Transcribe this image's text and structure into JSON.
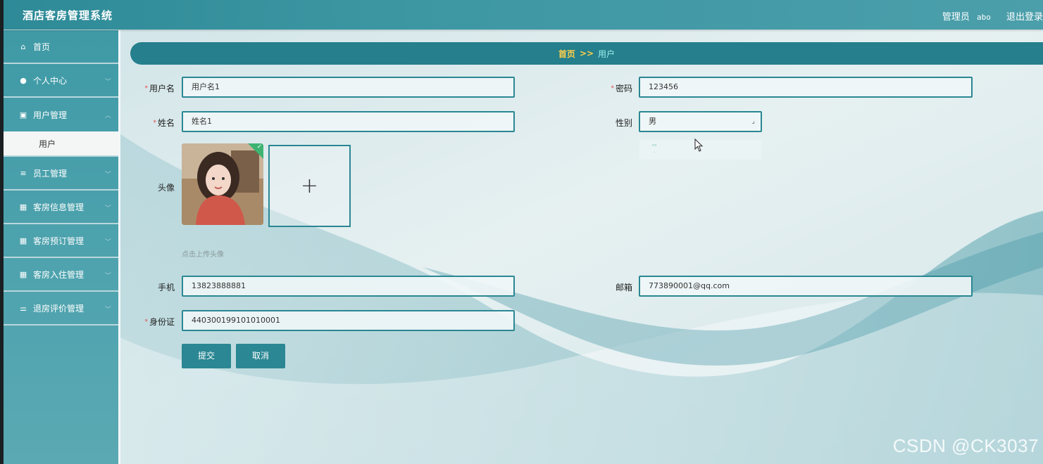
{
  "app": {
    "title": "酒店客房管理系统"
  },
  "topbar": {
    "role": "管理员",
    "username": "abo",
    "logout": "退出登录"
  },
  "sidebar": {
    "items": [
      {
        "label": "首页",
        "icon": "home-icon"
      },
      {
        "label": "个人中心",
        "icon": "user-icon"
      },
      {
        "label": "用户管理",
        "icon": "clipboard-icon"
      },
      {
        "label": "用户",
        "icon": ""
      },
      {
        "label": "员工管理",
        "icon": "list-icon"
      },
      {
        "label": "客房信息管理",
        "icon": "grid-icon"
      },
      {
        "label": "客房预订管理",
        "icon": "grid-icon"
      },
      {
        "label": "客房入住管理",
        "icon": "grid-icon"
      },
      {
        "label": "退房评价管理",
        "icon": "sliders-icon"
      }
    ]
  },
  "breadcrumb": {
    "home": "首页",
    "separator": ">>",
    "current": "用户"
  },
  "form": {
    "username": {
      "label": "用户名",
      "value": "用户名1"
    },
    "password": {
      "label": "密码",
      "value": "123456"
    },
    "name": {
      "label": "姓名",
      "value": "姓名1"
    },
    "gender": {
      "label": "性别",
      "value": "男"
    },
    "avatar": {
      "label": "头像",
      "tip": "点击上传头像",
      "add": "+"
    },
    "phone": {
      "label": "手机",
      "value": "13823888881"
    },
    "email": {
      "label": "邮箱",
      "value": "773890001@qq.com"
    },
    "idcard": {
      "label": "身份证",
      "value": "440300199101010001"
    },
    "submit": "提交",
    "cancel": "取消"
  },
  "watermark": "CSDN @CK3037",
  "colors": {
    "accent": "#2a8793",
    "sidebar": "#4ea3ae",
    "required": "#e04848",
    "breadcrumb_text": "#ffd04b"
  }
}
